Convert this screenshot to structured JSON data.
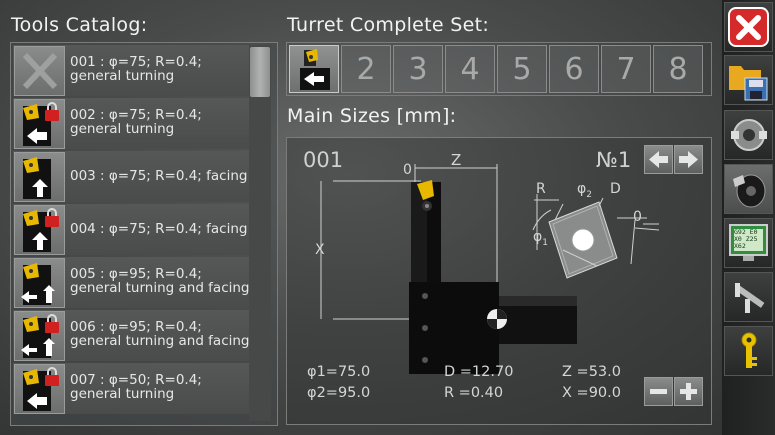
{
  "catalog": {
    "title": "Tools Catalog:",
    "items": [
      {
        "text": "001 : φ=75; R=0.4;\ngeneral turning",
        "locked": false,
        "icon": "empty-tool-icon"
      },
      {
        "text": "002 : φ=75; R=0.4;\ngeneral turning",
        "locked": true,
        "icon": "turning-tool-icon"
      },
      {
        "text": "003 : φ=75; R=0.4; facing",
        "locked": false,
        "icon": "facing-tool-icon"
      },
      {
        "text": "004 : φ=75; R=0.4; facing",
        "locked": true,
        "icon": "facing-tool-icon"
      },
      {
        "text": "005 : φ=95; R=0.4;\ngeneral turning and facing",
        "locked": false,
        "icon": "turning-facing-tool-icon"
      },
      {
        "text": "006 : φ=95; R=0.4;\ngeneral turning and facing",
        "locked": true,
        "icon": "turning-facing-tool-icon"
      },
      {
        "text": "007 : φ=50; R=0.4;\ngeneral turning",
        "locked": true,
        "icon": "turning-tool-icon"
      }
    ]
  },
  "turret": {
    "title": "Turret Complete Set:",
    "slots": [
      "",
      "2",
      "3",
      "4",
      "5",
      "6",
      "7",
      "8"
    ],
    "active_slot": 1
  },
  "main": {
    "title": "Main Sizes [mm]:",
    "tool_number": "001",
    "position_label": "№1",
    "dim_zero": "0",
    "dim_z": "Z",
    "dim_x": "X",
    "insert_labels": {
      "r": "R",
      "phi2": "φ",
      "phi2_sub": "2",
      "d": "D",
      "phi1": "φ",
      "phi1_sub": "1",
      "zero": "0"
    },
    "values": {
      "phi1": "φ1=75.0",
      "phi2": "φ2=95.0",
      "d": "D =12.70",
      "r": "R =0.40",
      "z": "Z =53.0",
      "x": "X =90.0"
    }
  },
  "toolbar": {
    "screen_text": [
      "G92 E0",
      "X0 Z25",
      "X62"
    ]
  },
  "colors": {
    "accent_close": "#d42a2a",
    "insert_yellow": "#e8b800",
    "lock_red": "#d02020"
  }
}
